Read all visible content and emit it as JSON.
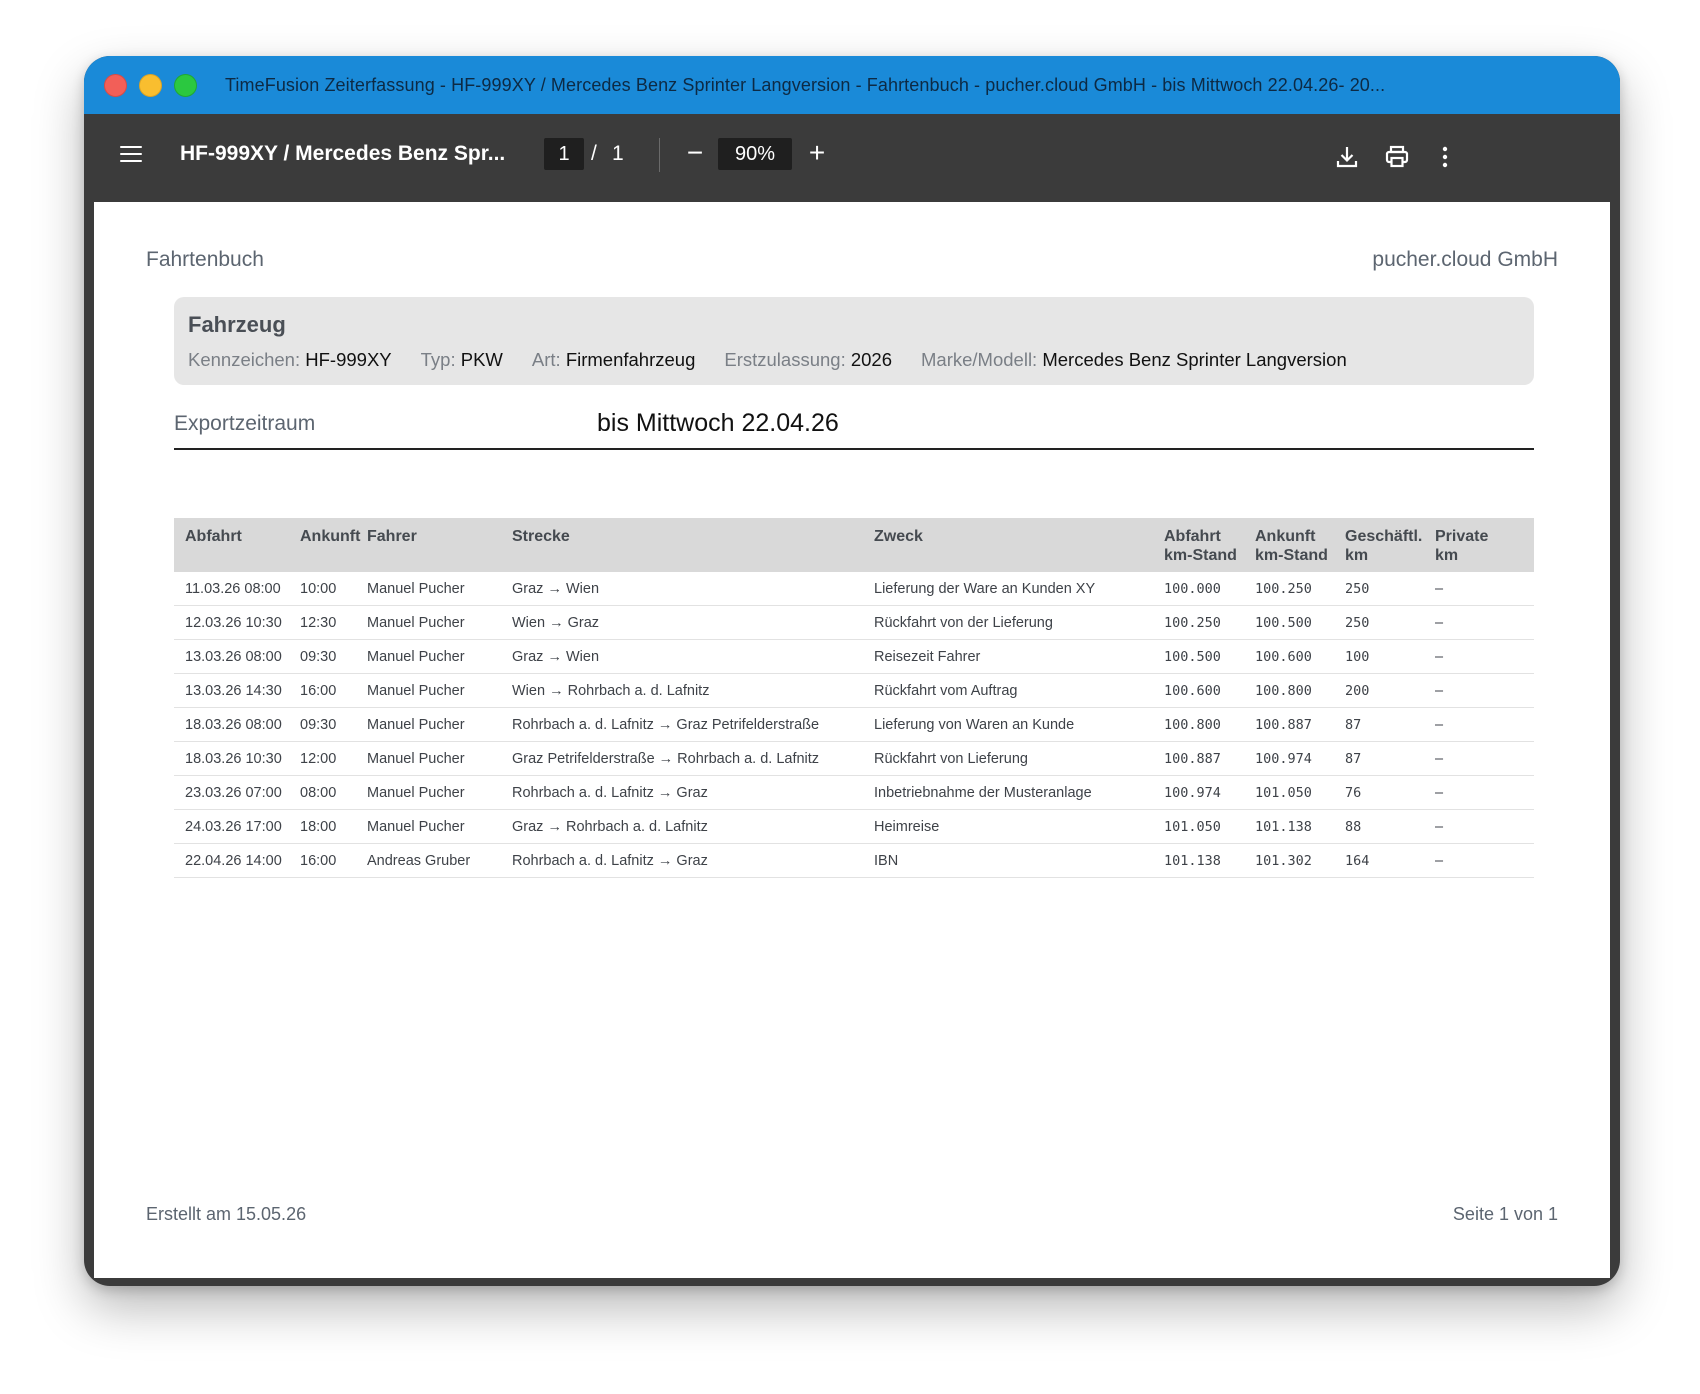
{
  "window": {
    "title": "TimeFusion Zeiterfassung - HF-999XY / Mercedes Benz Sprinter Langversion - Fahrtenbuch - pucher.cloud GmbH - bis Mittwoch 22.04.26- 20..."
  },
  "toolbar": {
    "doc_title": "HF-999XY / Mercedes Benz Spr...",
    "current_page": "1",
    "page_separator": "/",
    "total_pages": "1",
    "zoom": "90%",
    "zoom_out_label": "−",
    "zoom_in_label": "+",
    "icons": [
      "menu-icon",
      "download-icon",
      "print-icon",
      "more-vertical-icon"
    ]
  },
  "document": {
    "header_left": "Fahrtenbuch",
    "header_right": "pucher.cloud GmbH",
    "vehicle": {
      "title": "Fahrzeug",
      "fields": [
        {
          "label": "Kennzeichen:",
          "value": "HF-999XY"
        },
        {
          "label": "Typ:",
          "value": "PKW"
        },
        {
          "label": "Art:",
          "value": "Firmenfahrzeug"
        },
        {
          "label": "Erstzulassung:",
          "value": "2026"
        },
        {
          "label": "Marke/Modell:",
          "value": "Mercedes Benz Sprinter Langversion"
        }
      ]
    },
    "export": {
      "label": "Exportzeitraum",
      "value": "bis Mittwoch 22.04.26"
    },
    "table": {
      "headers": [
        [
          "Abfahrt"
        ],
        [
          "Ankunft"
        ],
        [
          "Fahrer"
        ],
        [
          "Strecke"
        ],
        [
          "Zweck"
        ],
        [
          "Abfahrt",
          "km-Stand"
        ],
        [
          "Ankunft",
          "km-Stand"
        ],
        [
          "Geschäftl.",
          "km"
        ],
        [
          "Private",
          "km"
        ]
      ],
      "rows": [
        [
          "11.03.26 08:00",
          "10:00",
          "Manuel Pucher",
          "Graz → Wien",
          "Lieferung der Ware an Kunden XY",
          "100.000",
          "100.250",
          "250",
          "–"
        ],
        [
          "12.03.26 10:30",
          "12:30",
          "Manuel Pucher",
          "Wien → Graz",
          "Rückfahrt von der Lieferung",
          "100.250",
          "100.500",
          "250",
          "–"
        ],
        [
          "13.03.26 08:00",
          "09:30",
          "Manuel Pucher",
          "Graz → Wien",
          "Reisezeit Fahrer",
          "100.500",
          "100.600",
          "100",
          "–"
        ],
        [
          "13.03.26 14:30",
          "16:00",
          "Manuel Pucher",
          "Wien → Rohrbach a. d. Lafnitz",
          "Rückfahrt vom Auftrag",
          "100.600",
          "100.800",
          "200",
          "–"
        ],
        [
          "18.03.26 08:00",
          "09:30",
          "Manuel Pucher",
          "Rohrbach a. d. Lafnitz → Graz Petrifelderstraße",
          "Lieferung von Waren an Kunde",
          "100.800",
          "100.887",
          "87",
          "–"
        ],
        [
          "18.03.26 10:30",
          "12:00",
          "Manuel Pucher",
          "Graz Petrifelderstraße → Rohrbach a. d. Lafnitz",
          "Rückfahrt von Lieferung",
          "100.887",
          "100.974",
          "87",
          "–"
        ],
        [
          "23.03.26 07:00",
          "08:00",
          "Manuel Pucher",
          "Rohrbach a. d. Lafnitz → Graz",
          "Inbetriebnahme der Musteranlage",
          "100.974",
          "101.050",
          "76",
          "–"
        ],
        [
          "24.03.26 17:00",
          "18:00",
          "Manuel Pucher",
          "Graz → Rohrbach a. d. Lafnitz",
          "Heimreise",
          "101.050",
          "101.138",
          "88",
          "–"
        ],
        [
          "22.04.26 14:00",
          "16:00",
          "Andreas Gruber",
          "Rohrbach a. d. Lafnitz → Graz",
          "IBN",
          "101.138",
          "101.302",
          "164",
          "–"
        ]
      ]
    },
    "footer_left": "Erstellt am 15.05.26",
    "footer_right": "Seite 1 von 1"
  },
  "colors": {
    "titlebar": "#1a8ad8",
    "toolbar": "#3b3b3b",
    "table_header": "#d9d9d9",
    "vehicle_box": "#e6e6e6"
  }
}
